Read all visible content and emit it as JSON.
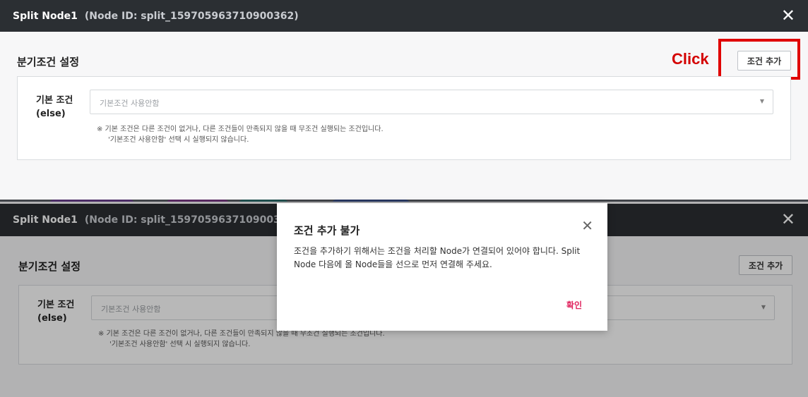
{
  "window": {
    "title": "Split Node1",
    "node_id": "(Node ID: split_159705963710900362)",
    "close_icon": "close-icon"
  },
  "section": {
    "title": "분기조건 설정",
    "add_button": "조건 추가"
  },
  "annotation": {
    "click_label": "Click",
    "highlight_color": "#e00000"
  },
  "default_condition": {
    "label_line1": "기본 조건",
    "label_line2": "(else)",
    "select_value": "기본조건 사용안함",
    "note_line1": "※ 기본 조건은 다른 조건이 없거나, 다른 조건들이 만족되지 않을 때 무조건 실행되는 조건입니다.",
    "note_line2": "'기본조건 사용안함' 선택 시 실행되지 않습니다."
  },
  "dialog": {
    "title": "조건 추가 불가",
    "message": "조건을 추가하기 위해서는 조건을 처리할 Node가 연결되어 있어야 합니다. Split Node 다음에 올 Node들을 선으로 먼저 연결해 주세요.",
    "confirm": "확인",
    "confirm_color": "#e0245e"
  },
  "colors": {
    "titlebar": "#2b2f33",
    "strip_blobs": [
      "#6a3f8f",
      "#7b3a86",
      "#2d6e6c",
      "#3a4f8a"
    ]
  }
}
